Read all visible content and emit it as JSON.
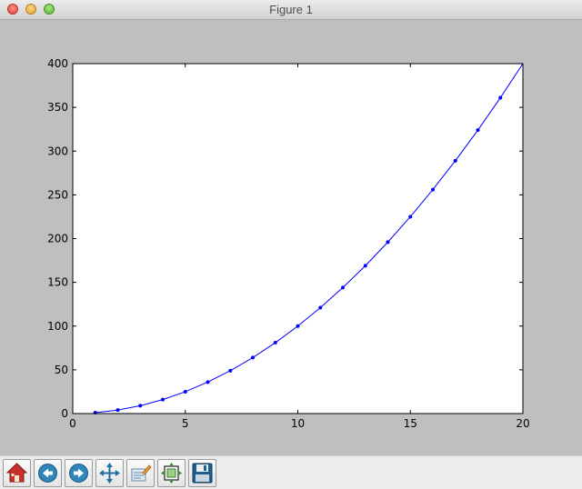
{
  "window": {
    "title": "Figure 1"
  },
  "toolbar": {
    "buttons": [
      {
        "name": "home-button",
        "icon": "home-icon"
      },
      {
        "name": "back-button",
        "icon": "back-arrow-icon"
      },
      {
        "name": "forward-button",
        "icon": "forward-arrow-icon"
      },
      {
        "name": "pan-button",
        "icon": "pan-arrows-icon"
      },
      {
        "name": "zoom-button",
        "icon": "zoom-rect-icon"
      },
      {
        "name": "subplots-button",
        "icon": "subplots-config-icon"
      },
      {
        "name": "save-button",
        "icon": "floppy-disk-icon"
      }
    ]
  },
  "chart_data": {
    "type": "line",
    "title": "",
    "xlabel": "",
    "ylabel": "",
    "xlim": [
      0,
      20
    ],
    "ylim": [
      0,
      400
    ],
    "xticks": [
      "0",
      "5",
      "10",
      "15",
      "20"
    ],
    "yticks": [
      "0",
      "50",
      "100",
      "150",
      "200",
      "250",
      "300",
      "350",
      "400"
    ],
    "grid": false,
    "line_color": "#0000ff",
    "series": [
      {
        "marker": "point",
        "x": [
          1,
          2,
          3,
          4,
          5,
          6,
          7,
          8,
          9,
          10,
          11,
          12,
          13,
          14,
          15,
          16,
          17,
          18,
          19
        ],
        "y": [
          1,
          4,
          9,
          16,
          25,
          36,
          49,
          64,
          81,
          100,
          121,
          144,
          169,
          196,
          225,
          256,
          289,
          324,
          361
        ]
      },
      {
        "marker": "none",
        "x": [
          1,
          2,
          3,
          4,
          5,
          6,
          7,
          8,
          9,
          10,
          11,
          12,
          13,
          14,
          15,
          16,
          17,
          18,
          19,
          20
        ],
        "y": [
          1,
          4,
          9,
          16,
          25,
          36,
          49,
          64,
          81,
          100,
          121,
          144,
          169,
          196,
          225,
          256,
          289,
          324,
          361,
          400
        ]
      }
    ]
  }
}
